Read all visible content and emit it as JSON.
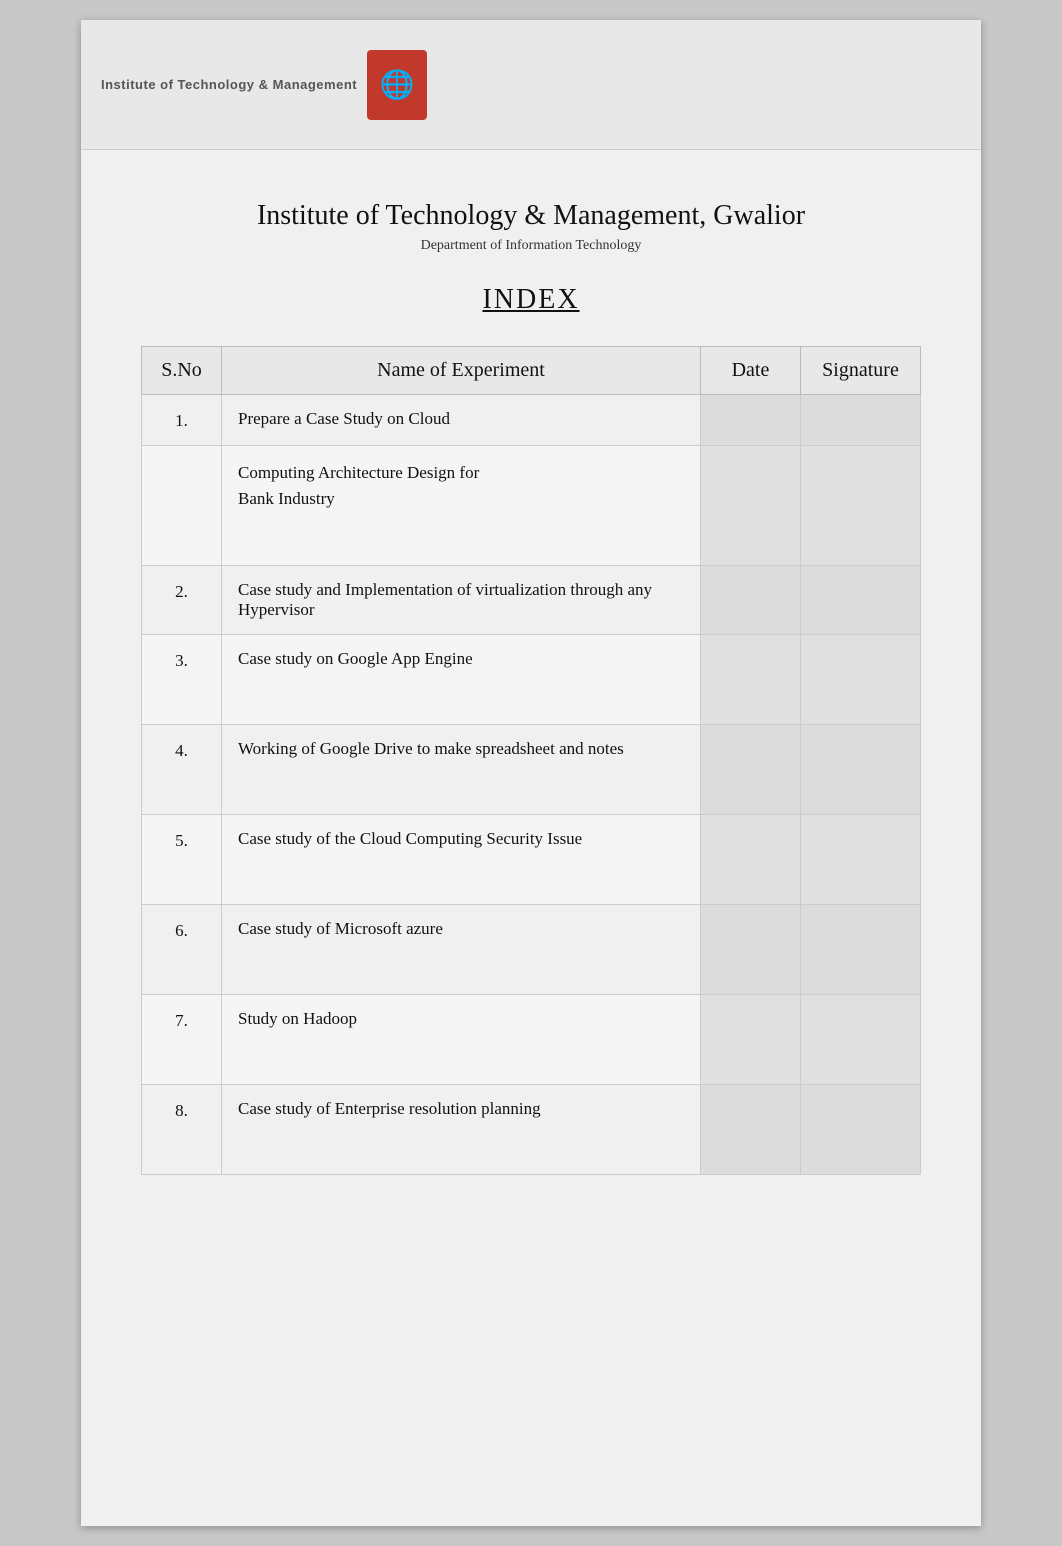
{
  "page": {
    "background_color": "#c8c8c8"
  },
  "header": {
    "logo_text": "Institute of Technology & Management",
    "logo_icon_text": "🌐"
  },
  "institution": {
    "name": "Institute of Technology & Management, Gwalior",
    "department": "Department of Information Technology"
  },
  "index_title": "INDEX",
  "table": {
    "headers": [
      "S.No",
      "Name of Experiment",
      "Date",
      "Signature"
    ],
    "rows": [
      {
        "sno": "1.",
        "experiment": "Prepare a Case Study on Cloud Computing Architecture Design for Bank Industry",
        "experiment_short": "Prepare a Case Study on Cloud",
        "date": "",
        "signature": ""
      },
      {
        "sno": "2.",
        "experiment": "Case study and Implementation of virtualization through any Hypervisor",
        "date": "",
        "signature": ""
      },
      {
        "sno": "3.",
        "experiment": "Case study on Google App Engine",
        "date": "",
        "signature": ""
      },
      {
        "sno": "4.",
        "experiment": "Working of Google Drive to make spreadsheet and notes",
        "date": "",
        "signature": ""
      },
      {
        "sno": "5.",
        "experiment": "Case study of the Cloud Computing Security Issue",
        "date": "",
        "signature": ""
      },
      {
        "sno": "6.",
        "experiment": "Case study of Microsoft azure",
        "date": "",
        "signature": ""
      },
      {
        "sno": "7.",
        "experiment": "Study on Hadoop",
        "date": "",
        "signature": ""
      },
      {
        "sno": "8.",
        "experiment": "Case study of Enterprise resolution planning",
        "date": "",
        "signature": ""
      }
    ]
  }
}
